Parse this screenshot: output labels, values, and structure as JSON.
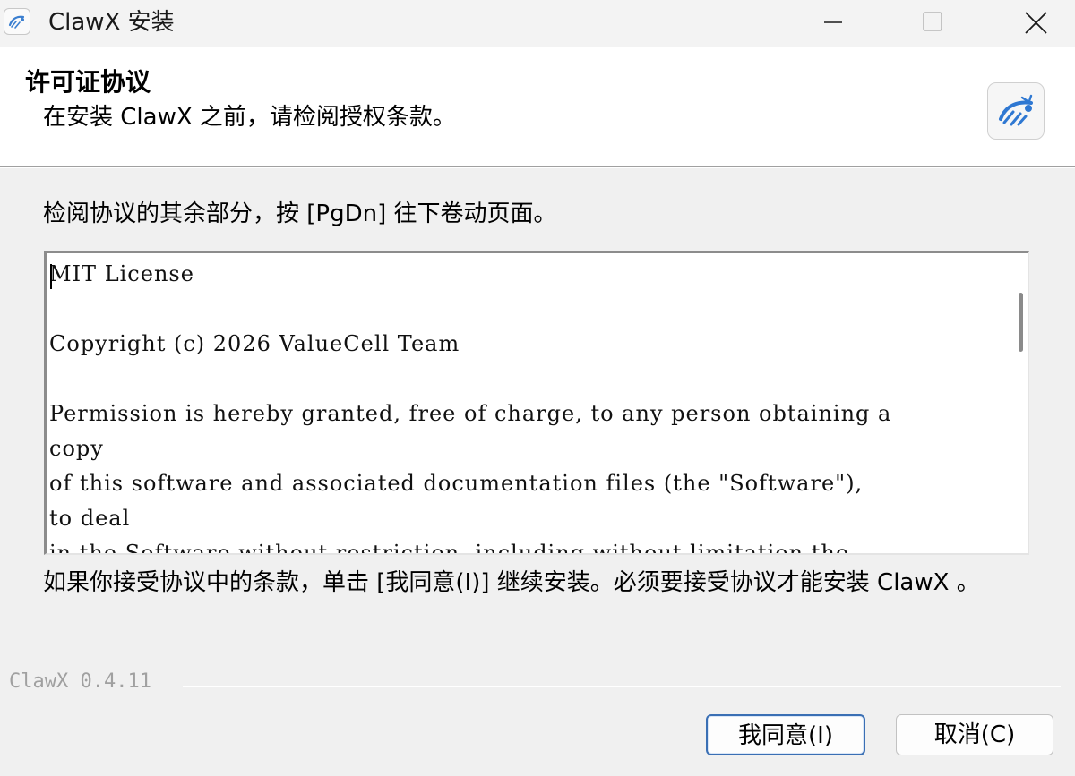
{
  "window": {
    "title": "ClawX 安装",
    "controls": {
      "minimize_icon": "minimize-icon",
      "maximize_icon": "maximize-icon",
      "close_icon": "close-icon"
    }
  },
  "header": {
    "title": "许可证协议",
    "subtitle": "在安装 ClawX 之前，请检阅授权条款。",
    "logo_icon": "clawx-logo-icon"
  },
  "body": {
    "instruction": "检阅协议的其余部分，按 [PgDn] 往下卷动页面。",
    "license_lines": [
      "MIT License",
      "",
      "Copyright (c) 2026 ValueCell Team",
      "",
      "Permission is hereby granted, free of charge, to any person obtaining a",
      "copy",
      "of this software and associated documentation files (the \"Software\"),",
      "to deal",
      "in the Software without restriction, including without limitation the"
    ],
    "accept_text": "如果你接受协议中的条款，单击 [我同意(I)] 继续安装。必须要接受协议才能安装 ClawX 。"
  },
  "footer": {
    "version": "ClawX 0.4.11",
    "agree_button": "我同意(I)",
    "cancel_button": "取消(C)"
  },
  "colors": {
    "background": "#f0f0f0",
    "header_background": "#ffffff",
    "default_button_border": "#3a6fb4",
    "version_text": "#a0a0a0"
  }
}
